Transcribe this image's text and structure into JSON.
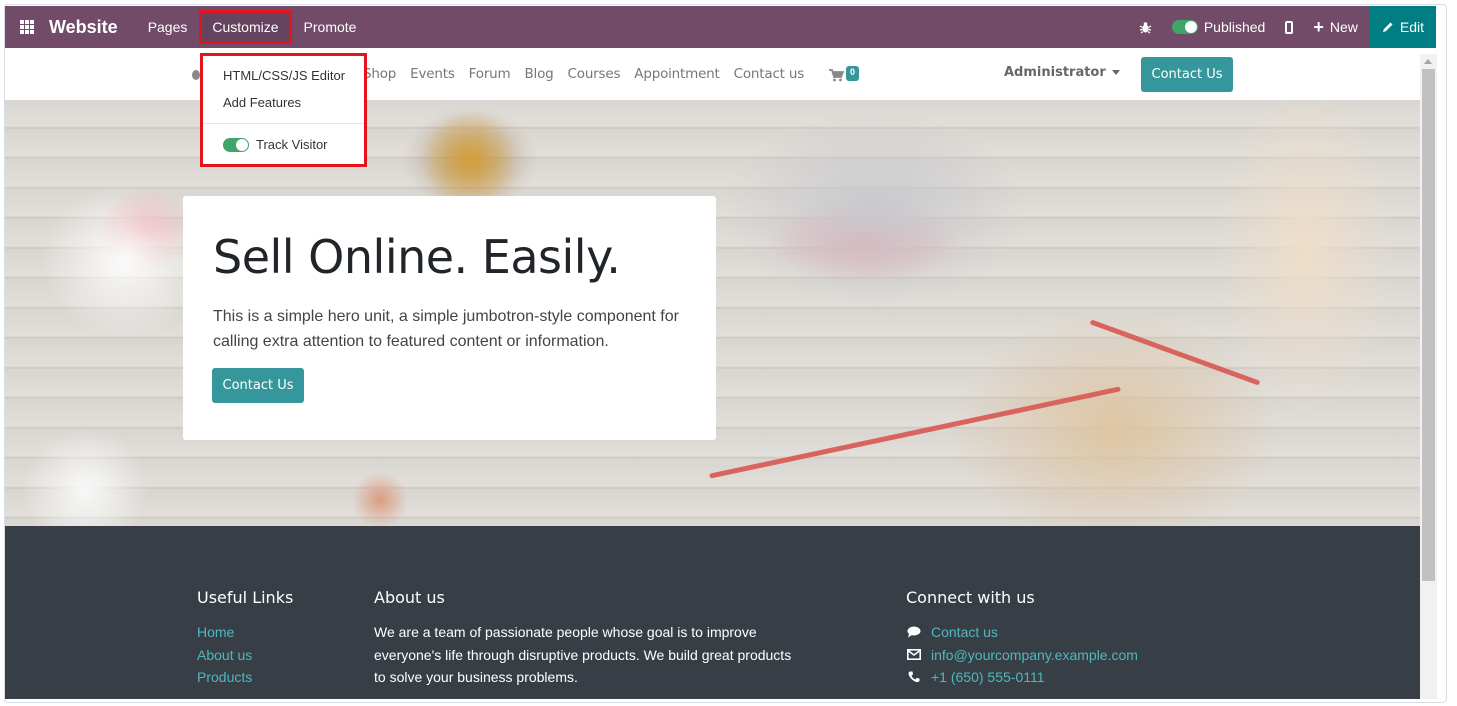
{
  "topbar": {
    "apps_icon": "apps-grid-icon",
    "brand": "Website",
    "menus": [
      "Pages",
      "Customize",
      "Promote"
    ],
    "active_menu": "Customize",
    "debug_icon": "bug-icon",
    "published_label": "Published",
    "published_on": true,
    "mobile_icon": "mobile-icon",
    "new_label": "New",
    "new_icon": "plus-icon",
    "edit_label": "Edit",
    "edit_icon": "pencil-icon"
  },
  "customize_menu": {
    "items": [
      "HTML/CSS/JS Editor",
      "Add Features"
    ],
    "toggle_label": "Track Visitor",
    "toggle_on": true
  },
  "site_header": {
    "nav": [
      "Shop",
      "Events",
      "Forum",
      "Blog",
      "Courses",
      "Appointment",
      "Contact us"
    ],
    "cart_icon": "shopping-cart-icon",
    "cart_count": "0",
    "user": "Administrator",
    "cta": "Contact Us"
  },
  "hero": {
    "title": "Sell Online. Easily.",
    "text": "This is a simple hero unit, a simple jumbotron-style component for calling extra attention to featured content or information.",
    "button": "Contact Us"
  },
  "footer": {
    "useful_links": {
      "title": "Useful Links",
      "links": [
        "Home",
        "About us",
        "Products"
      ]
    },
    "about": {
      "title": "About us",
      "text": "We are a team of passionate people whose goal is to improve everyone's life through disruptive products. We build great products to solve your business problems."
    },
    "connect": {
      "title": "Connect with us",
      "items": [
        {
          "icon": "comment-icon",
          "label": "Contact us"
        },
        {
          "icon": "envelope-icon",
          "label": "info@yourcompany.example.com"
        },
        {
          "icon": "phone-icon",
          "label": "+1 (650) 555-0111"
        }
      ]
    }
  },
  "colors": {
    "odoo_purple": "#714b67",
    "edit_teal": "#017e84",
    "site_teal": "#35979c",
    "footer_bg": "#383e45",
    "footer_link": "#4fb8be",
    "highlight_red": "#e3141c",
    "toggle_green": "#3fa56b"
  }
}
